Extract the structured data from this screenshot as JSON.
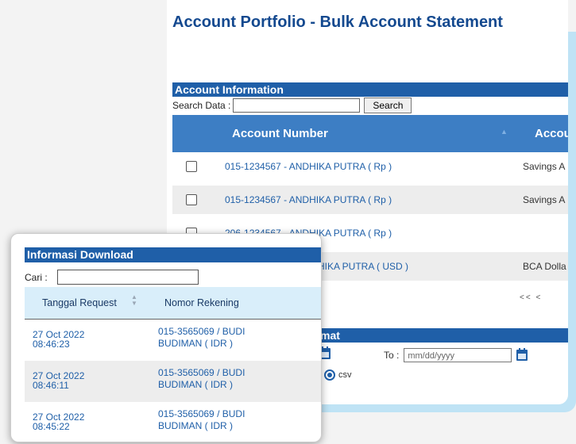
{
  "main": {
    "title": "Account Portfolio - Bulk Account Statement",
    "account_info_header": "Account Information",
    "search_label": "Search Data :",
    "search_value": "",
    "search_button": "Search",
    "columns": [
      "Account Number",
      "Accou"
    ],
    "rows": [
      {
        "number": "015-1234567 - ANDHIKA PUTRA ( Rp )",
        "type": "Savings A",
        "checked": false
      },
      {
        "number": "015-1234567 - ANDHIKA PUTRA ( Rp )",
        "type": "Savings A",
        "checked": false
      },
      {
        "number": "206-1234567 - ANDHIKA PUTRA ( Rp )",
        "type": "",
        "checked": false
      },
      {
        "number": "HIKA PUTRA ( USD )",
        "type": "BCA Dolla",
        "checked": false
      }
    ],
    "pager": "<<  <",
    "format_header": "ormat",
    "to_label": "To :",
    "date_placeholder": "mm/dd/yyyy",
    "csv_label": "csv",
    "csv_selected": true
  },
  "popup": {
    "title": "Informasi Download",
    "search_label": "Cari :",
    "search_value": "",
    "columns": [
      "Tanggal Request",
      "Nomor Rekening"
    ],
    "rows": [
      {
        "date": "27 Oct 2022",
        "time": "08:46:23",
        "account": "015-3565069 / BUDI",
        "account2": "BUDIMAN ( IDR )"
      },
      {
        "date": "27 Oct 2022",
        "time": "08:46:11",
        "account": "015-3565069 / BUDI",
        "account2": "BUDIMAN ( IDR )"
      },
      {
        "date": "27 Oct 2022",
        "time": "08:45:22",
        "account": "015-3565069 / BUDI",
        "account2": "BUDIMAN ( IDR )"
      }
    ]
  },
  "colors": {
    "header_blue": "#1f5fa8",
    "table_head_blue": "#3d7ec4",
    "link_blue": "#1f5fa8",
    "accent_bg": "#bfe3f5",
    "popup_head_bg": "#d9eefa"
  }
}
